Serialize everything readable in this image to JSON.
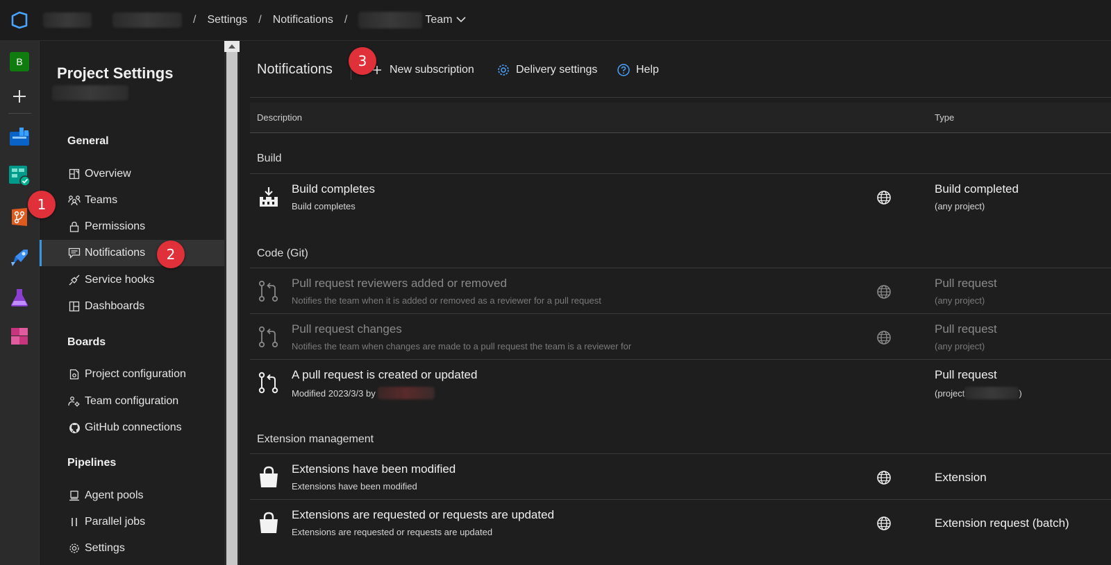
{
  "breadcrumb": {
    "settings": "Settings",
    "notifications": "Notifications",
    "team_suffix": "Team"
  },
  "rail": {
    "avatar_letter": "B"
  },
  "sidebar": {
    "title": "Project Settings",
    "sections": [
      {
        "label": "General",
        "items": [
          {
            "label": "Overview",
            "icon": "overview-icon"
          },
          {
            "label": "Teams",
            "icon": "teams-icon"
          },
          {
            "label": "Permissions",
            "icon": "lock-icon"
          },
          {
            "label": "Notifications",
            "icon": "comment-icon",
            "active": true
          },
          {
            "label": "Service hooks",
            "icon": "plug-icon"
          },
          {
            "label": "Dashboards",
            "icon": "dashboard-icon"
          }
        ]
      },
      {
        "label": "Boards",
        "items": [
          {
            "label": "Project configuration",
            "icon": "config-icon"
          },
          {
            "label": "Team configuration",
            "icon": "team-config-icon"
          },
          {
            "label": "GitHub connections",
            "icon": "github-icon"
          }
        ]
      },
      {
        "label": "Pipelines",
        "items": [
          {
            "label": "Agent pools",
            "icon": "agent-icon"
          },
          {
            "label": "Parallel jobs",
            "icon": "parallel-icon"
          },
          {
            "label": "Settings",
            "icon": "gear-icon"
          }
        ]
      }
    ]
  },
  "commandbar": {
    "title": "Notifications",
    "new_subscription": "New subscription",
    "delivery_settings": "Delivery settings",
    "help": "Help"
  },
  "table": {
    "col_description": "Description",
    "col_type": "Type",
    "groups": [
      {
        "title": "Build",
        "rows": [
          {
            "title": "Build completes",
            "subtitle": "Build completes",
            "type": "Build completed",
            "type_sub": "(any project)",
            "globe": true,
            "dim": false
          }
        ]
      },
      {
        "title": "Code (Git)",
        "rows": [
          {
            "title": "Pull request reviewers added or removed",
            "subtitle": "Notifies the team when it is added or removed as a reviewer for a pull request",
            "type": "Pull request",
            "type_sub": "(any project)",
            "globe": true,
            "dim": true
          },
          {
            "title": "Pull request changes",
            "subtitle": "Notifies the team when changes are made to a pull request the team is a reviewer for",
            "type": "Pull request",
            "type_sub": "(any project)",
            "globe": true,
            "dim": true
          },
          {
            "title": "A pull request is created or updated",
            "subtitle": "Modified 2023/3/3 by",
            "type": "Pull request",
            "type_sub": "(project",
            "type_sub_end": ")",
            "globe": false,
            "dim": false
          }
        ]
      },
      {
        "title": "Extension management",
        "rows": [
          {
            "title": "Extensions have been modified",
            "subtitle": "Extensions have been modified",
            "type": "Extension",
            "type_sub": "",
            "globe": true,
            "dim": false
          },
          {
            "title": "Extensions are requested or requests are updated",
            "subtitle": "Extensions are requested or requests are updated",
            "type": "Extension request (batch)",
            "type_sub": "",
            "globe": true,
            "dim": false
          }
        ]
      }
    ]
  },
  "annotations": [
    "1",
    "2",
    "3"
  ],
  "colors": {
    "accent": "#3a96dd",
    "badge": "#e0303a",
    "background": "#1e1e1e"
  }
}
